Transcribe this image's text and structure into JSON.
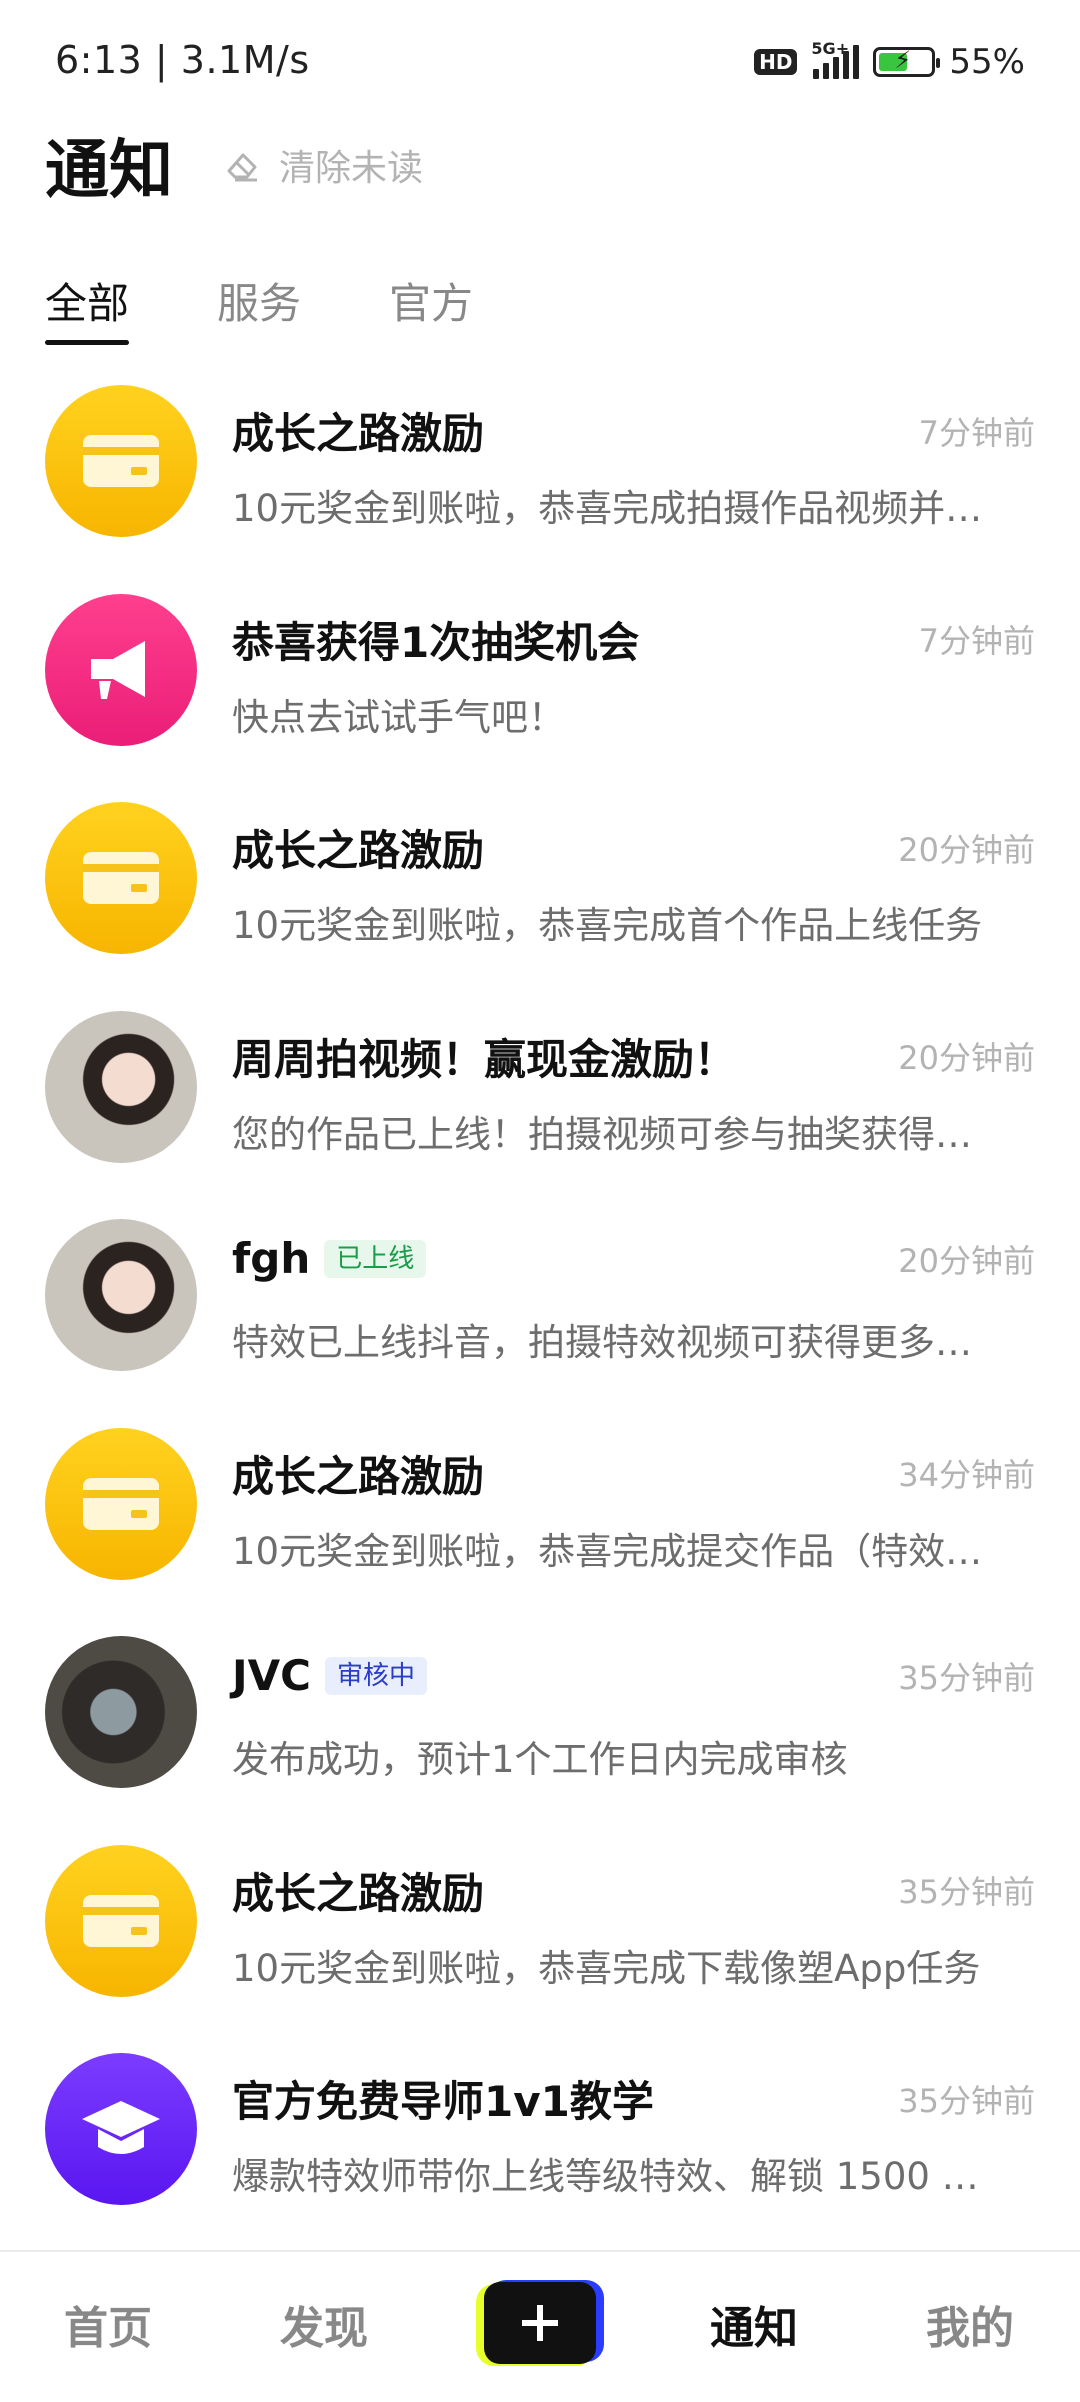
{
  "status_bar": {
    "time_speed": "6:13 | 3.1M/s",
    "hd": "HD",
    "network": "5G+",
    "battery": "55%"
  },
  "header": {
    "title": "通知",
    "clear_unread": "清除未读"
  },
  "tabs": [
    {
      "label": "全部",
      "active": true
    },
    {
      "label": "服务",
      "active": false
    },
    {
      "label": "官方",
      "active": false
    }
  ],
  "notifications": [
    {
      "title": "成长之路激励",
      "time": "7分钟前",
      "text": "10元奖金到账啦，恭喜完成拍摄作品视频并…",
      "icon": "wallet-icon"
    },
    {
      "title": "恭喜获得1次抽奖机会",
      "time": "7分钟前",
      "text": "快点去试试手气吧！",
      "icon": "megaphone-icon"
    },
    {
      "title": "成长之路激励",
      "time": "20分钟前",
      "text": "10元奖金到账啦，恭喜完成首个作品上线任务",
      "icon": "wallet-icon"
    },
    {
      "title": "周周拍视频！赢现金激励！",
      "time": "20分钟前",
      "text": "您的作品已上线！拍摄视频可参与抽奖获得…",
      "icon": "user-avatar"
    },
    {
      "title": "fgh",
      "badge": "已上线",
      "time": "20分钟前",
      "text": "特效已上线抖音，拍摄特效视频可获得更多…",
      "icon": "user-avatar"
    },
    {
      "title": "成长之路激励",
      "time": "34分钟前",
      "text": "10元奖金到账啦，恭喜完成提交作品（特效…",
      "icon": "wallet-icon"
    },
    {
      "title": "JVC",
      "badge": "审核中",
      "time": "35分钟前",
      "text": "发布成功，预计1个工作日内完成审核",
      "icon": "user-avatar"
    },
    {
      "title": "成长之路激励",
      "time": "35分钟前",
      "text": "10元奖金到账啦，恭喜完成下载像塑App任务",
      "icon": "wallet-icon"
    },
    {
      "title": "官方免费导师1v1教学",
      "time": "35分钟前",
      "text": "爆款特效师带你上线等级特效、解锁 1500 …",
      "icon": "graduation-cap-icon"
    }
  ],
  "bottom_nav": {
    "home": "首页",
    "discover": "发现",
    "add": "+",
    "notifications": "通知",
    "me": "我的"
  }
}
